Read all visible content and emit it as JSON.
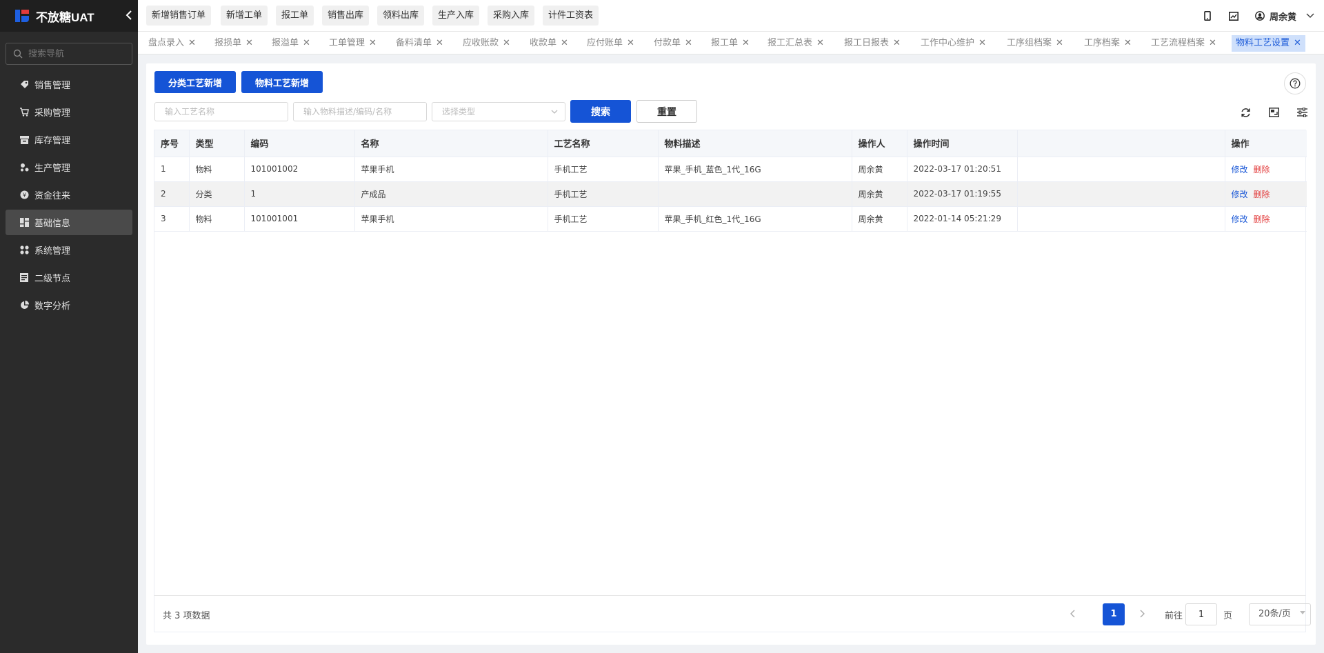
{
  "app": {
    "logo_text": "不放糖UAT"
  },
  "sidebar": {
    "search_placeholder": "搜索导航",
    "items": [
      {
        "label": "销售管理",
        "icon": "tag-icon"
      },
      {
        "label": "采购管理",
        "icon": "cart-icon"
      },
      {
        "label": "库存管理",
        "icon": "archive-icon"
      },
      {
        "label": "生产管理",
        "icon": "nodes-icon"
      },
      {
        "label": "资金往来",
        "icon": "money-icon"
      },
      {
        "label": "基础信息",
        "icon": "dashboard-icon",
        "active": true
      },
      {
        "label": "系统管理",
        "icon": "grid-icon"
      },
      {
        "label": "二级节点",
        "icon": "document-icon"
      },
      {
        "label": "数字分析",
        "icon": "pie-icon"
      }
    ]
  },
  "topbar": {
    "quick_actions": [
      "新增销售订单",
      "新增工单",
      "报工单",
      "销售出库",
      "领料出库",
      "生产入库",
      "采购入库",
      "计件工资表"
    ],
    "user_name": "周余黄"
  },
  "tabs": [
    {
      "label": "盘点录入"
    },
    {
      "label": "报损单"
    },
    {
      "label": "报溢单"
    },
    {
      "label": "工单管理"
    },
    {
      "label": "备料清单"
    },
    {
      "label": "应收账款"
    },
    {
      "label": "收款单"
    },
    {
      "label": "应付账单"
    },
    {
      "label": "付款单"
    },
    {
      "label": "报工单"
    },
    {
      "label": "报工汇总表"
    },
    {
      "label": "报工日报表"
    },
    {
      "label": "工作中心维护"
    },
    {
      "label": "工序组档案"
    },
    {
      "label": "工序档案"
    },
    {
      "label": "工艺流程档案"
    },
    {
      "label": "物料工艺设置",
      "active": true
    }
  ],
  "actions": {
    "add_category": "分类工艺新增",
    "add_material": "物料工艺新增"
  },
  "filters": {
    "process_name_placeholder": "输入工艺名称",
    "material_placeholder": "输入物料描述/编码/名称",
    "type_placeholder": "选择类型",
    "search_label": "搜索",
    "reset_label": "重置"
  },
  "table": {
    "columns": [
      "序号",
      "类型",
      "编码",
      "名称",
      "工艺名称",
      "物料描述",
      "操作人",
      "操作时间",
      "",
      "操作"
    ],
    "rows": [
      {
        "index": "1",
        "type": "物料",
        "code": "101001002",
        "name": "苹果手机",
        "process": "手机工艺",
        "desc": "苹果_手机_蓝色_1代_16G",
        "operator": "周余黄",
        "time": "2022-03-17 01:20:51",
        "blank": "",
        "edit": "修改",
        "del": "删除"
      },
      {
        "index": "2",
        "type": "分类",
        "code": "1",
        "name": "产成品",
        "process": "手机工艺",
        "desc": "",
        "operator": "周余黄",
        "time": "2022-03-17 01:19:55",
        "blank": "",
        "edit": "修改",
        "del": "删除"
      },
      {
        "index": "3",
        "type": "物料",
        "code": "101001001",
        "name": "苹果手机",
        "process": "手机工艺",
        "desc": "苹果_手机_红色_1代_16G",
        "operator": "周余黄",
        "time": "2022-01-14 05:21:29",
        "blank": "",
        "edit": "修改",
        "del": "删除"
      }
    ]
  },
  "pagination": {
    "total_text": "共 3 项数据",
    "current_page": "1",
    "goto_label": "前往",
    "goto_value": "1",
    "page_label": "页",
    "page_size": "20条/页"
  },
  "colors": {
    "primary": "#1554d6",
    "danger": "#e23b3b",
    "sidebar_bg": "#2b2b2b"
  }
}
